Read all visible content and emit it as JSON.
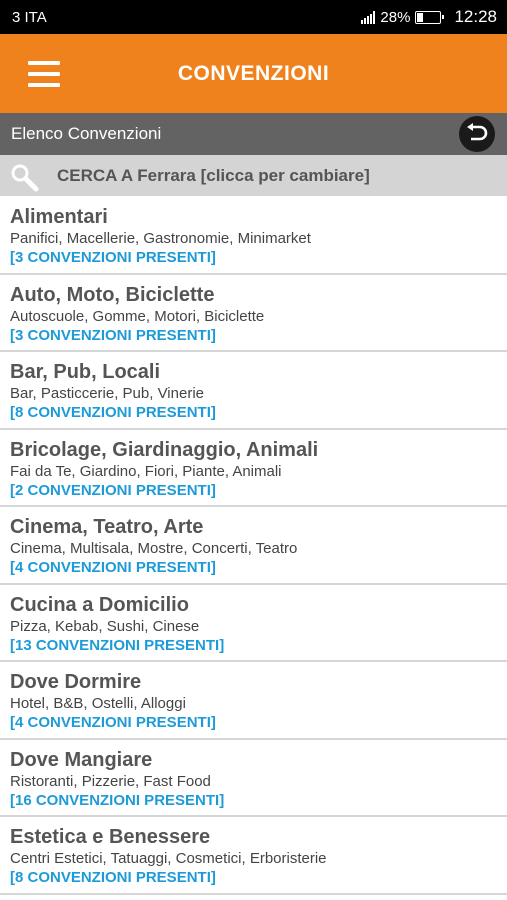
{
  "status_bar": {
    "carrier": "3 ITA",
    "battery_percent": "28%",
    "time": "12:28"
  },
  "app_bar": {
    "title": "CONVENZIONI",
    "menu_icon": "hamburger-menu-icon",
    "background_color": "#f0821e"
  },
  "sub_header": {
    "title": "Elenco Convenzioni",
    "back_icon": "back-arrow-icon"
  },
  "search": {
    "text": "CERCA A Ferrara [clicca per cambiare]",
    "icon": "search-icon"
  },
  "categories": [
    {
      "title": "Alimentari",
      "subtitle": "Panifici, Macellerie, Gastronomie, Minimarket",
      "count": "[3 CONVENZIONI PRESENTI]"
    },
    {
      "title": "Auto, Moto, Biciclette",
      "subtitle": "Autoscuole, Gomme, Motori, Biciclette",
      "count": "[3 CONVENZIONI PRESENTI]"
    },
    {
      "title": "Bar, Pub, Locali",
      "subtitle": "Bar, Pasticcerie, Pub, Vinerie",
      "count": "[8 CONVENZIONI PRESENTI]"
    },
    {
      "title": "Bricolage, Giardinaggio, Animali",
      "subtitle": "Fai da Te, Giardino, Fiori, Piante, Animali",
      "count": "[2 CONVENZIONI PRESENTI]"
    },
    {
      "title": "Cinema, Teatro, Arte",
      "subtitle": "Cinema, Multisala, Mostre, Concerti, Teatro",
      "count": "[4 CONVENZIONI PRESENTI]"
    },
    {
      "title": "Cucina a Domicilio",
      "subtitle": "Pizza, Kebab, Sushi, Cinese",
      "count": "[13 CONVENZIONI PRESENTI]"
    },
    {
      "title": "Dove Dormire",
      "subtitle": "Hotel, B&B, Ostelli, Alloggi",
      "count": "[4 CONVENZIONI PRESENTI]"
    },
    {
      "title": "Dove Mangiare",
      "subtitle": "Ristoranti, Pizzerie, Fast Food",
      "count": "[16 CONVENZIONI PRESENTI]"
    },
    {
      "title": "Estetica e Benessere",
      "subtitle": "Centri Estetici, Tatuaggi, Cosmetici, Erboristerie",
      "count": "[8 CONVENZIONI PRESENTI]"
    }
  ]
}
